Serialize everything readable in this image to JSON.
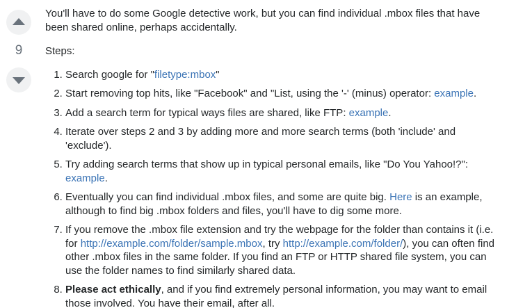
{
  "vote": {
    "count": "9",
    "up_icon": "arrow-up-icon",
    "down_icon": "arrow-down-icon"
  },
  "intro": "You'll have to do some Google detective work, but you can find individual .mbox files that have been shared online, perhaps accidentally.",
  "steps_label": "Steps:",
  "steps": [
    {
      "t1": "Search google for \"",
      "link": "filetype:mbox",
      "t2": "\""
    },
    {
      "t1": "Start removing top hits, like \"Facebook\" and \"List, using the '-' (minus) operator: ",
      "link": "example",
      "t2": "."
    },
    {
      "t1": "Add a search term for typical ways files are shared, like FTP: ",
      "link": "example",
      "t2": "."
    },
    {
      "t1": "Iterate over steps 2 and 3 by adding more and more search terms (both 'include' and 'exclude')."
    },
    {
      "t1": "Try adding search terms that show up in typical personal emails, like \"Do You Yahoo!?\": ",
      "link": "example",
      "t2": "."
    },
    {
      "t1": "Eventually you can find individual .mbox files, and some are quite big. ",
      "link": "Here",
      "t2": " is an example, although to find big .mbox folders and files, you'll have to dig some more."
    },
    {
      "t1": "If you remove the .mbox file extension and try the webpage for the folder than contains it (i.e. for ",
      "link": "http://example.com/folder/sample.mbox",
      "t2": ", try ",
      "link2": "http://example.com/folder/",
      "t3": "), you can often find other .mbox files in the same folder. If you find an FTP or HTTP shared file system, you can use the folder names to find similarly shared data."
    },
    {
      "bold": "Please act ethically",
      "t1": ", and if you find extremely personal information, you may want to email those involved. You have their email, after all."
    }
  ],
  "colors": {
    "text": "#242729",
    "link": "#3a73b5",
    "vote_bg": "#f0f1f2",
    "vote_icon": "#6a737c"
  }
}
